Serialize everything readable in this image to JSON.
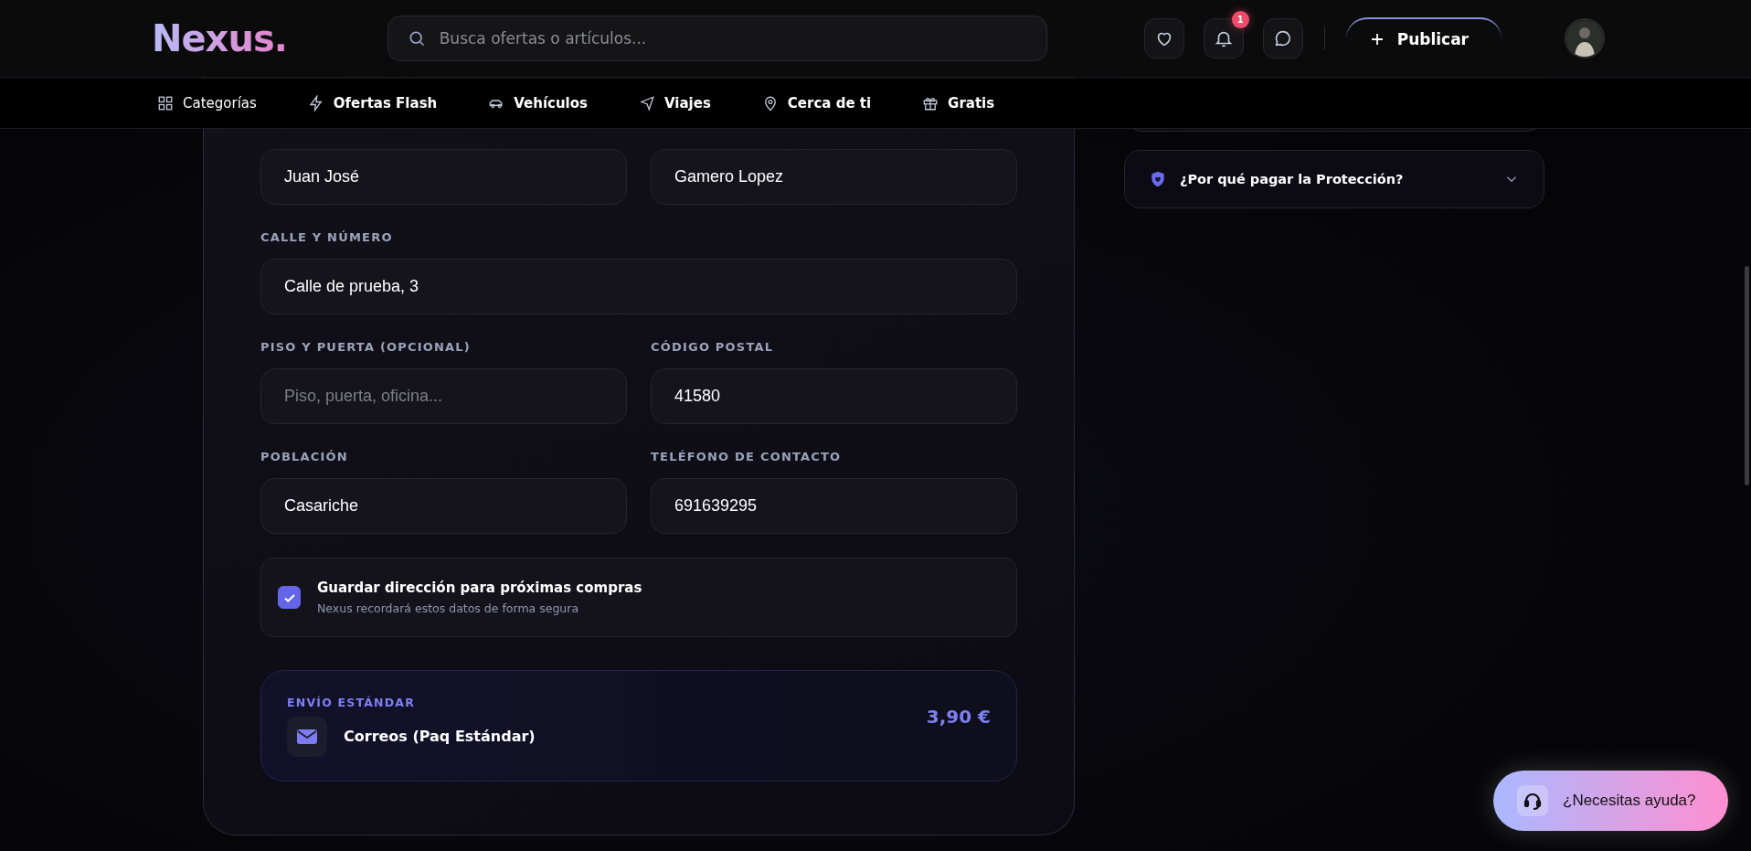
{
  "header": {
    "logo": "Nexus.",
    "search": {
      "placeholder": "Busca ofertas o artículos..."
    },
    "notification_count": "1",
    "publish_button": "Publicar"
  },
  "nav": [
    {
      "label": "Categorías"
    },
    {
      "label": "Ofertas Flash"
    },
    {
      "label": "Vehículos"
    },
    {
      "label": "Viajes"
    },
    {
      "label": "Cerca de ti"
    },
    {
      "label": "Gratis"
    }
  ],
  "form": {
    "fields": [
      {
        "value": "Juan José",
        "kind": "half"
      },
      {
        "value": "Gamero Lopez",
        "kind": "half"
      },
      {
        "label": "CALLE Y NÚMERO",
        "value": "Calle de prueba, 3",
        "kind": "wide"
      },
      {
        "label": "PISO Y PUERTA (OPCIONAL)",
        "placeholder": "Piso, puerta, oficina...",
        "kind": "half"
      },
      {
        "label": "CÓDIGO POSTAL",
        "value": "41580",
        "kind": "half"
      },
      {
        "label": "POBLACIÓN",
        "value": "Casariche",
        "kind": "half"
      },
      {
        "label": "TELÉFONO DE CONTACTO",
        "value": "691639295",
        "kind": "half"
      }
    ],
    "save_address": {
      "title": "Guardar dirección para próximas compras",
      "subtitle": "Nexus recordará estos datos de forma segura",
      "checked": true
    },
    "shipping": {
      "label": "ENVÍO ESTÁNDAR",
      "carrier": "Correos (Paq Estándar)",
      "price": "3,90 €"
    }
  },
  "sidebar": {
    "accordion": {
      "title": "¿Por qué pagar la Protección?",
      "expanded": false
    }
  },
  "help_button": "¿Necesitas ayuda?"
}
